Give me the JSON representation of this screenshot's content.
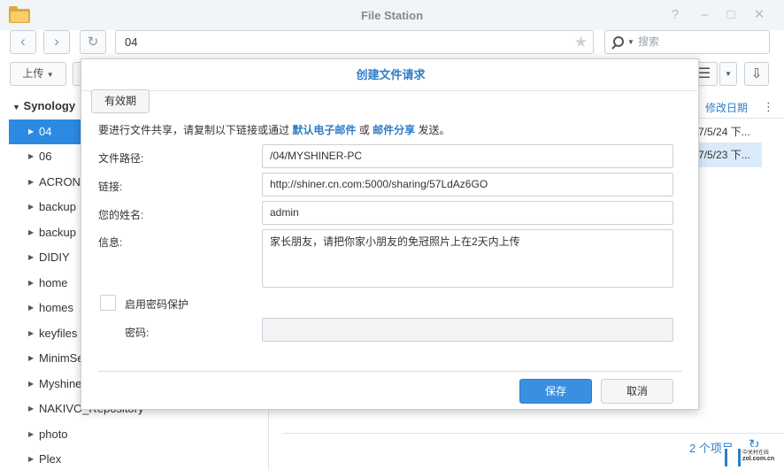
{
  "window": {
    "title": "File Station",
    "controls": [
      "?",
      "–",
      "□",
      "✕"
    ]
  },
  "toolbar": {
    "path": "04",
    "search_placeholder": "搜索",
    "upload_label": "上传"
  },
  "tree": {
    "root": "Synology",
    "items": [
      {
        "label": "04",
        "selected": true
      },
      {
        "label": "06"
      },
      {
        "label": "ACRONI"
      },
      {
        "label": "backup"
      },
      {
        "label": "backup"
      },
      {
        "label": "DIDIY"
      },
      {
        "label": "home"
      },
      {
        "label": "homes"
      },
      {
        "label": "keyfiles"
      },
      {
        "label": "MinimSe"
      },
      {
        "label": "Myshine"
      },
      {
        "label": "NAKIVO_Repository"
      },
      {
        "label": "photo"
      },
      {
        "label": "Plex"
      }
    ]
  },
  "list": {
    "column_modified": "修改日期",
    "rows": [
      {
        "modified": "7/5/24 下..."
      },
      {
        "modified": "7/5/23 下...",
        "selected": true
      }
    ],
    "item_count": "2 个项目"
  },
  "watermark": {
    "line1": "中关村在线",
    "line2": "zol.com.cn"
  },
  "dialog": {
    "title": "创建文件请求",
    "tab_label": "有效期",
    "intro_prefix": "要进行文件共享，请复制以下链接或通过",
    "intro_link1": "默认电子邮件",
    "intro_mid": "或",
    "intro_link2": "邮件分享",
    "intro_suffix": "发送。",
    "path_label": "文件路径:",
    "path_value": "/04/MYSHINER-PC",
    "link_label": "链接:",
    "link_value": "http://shiner.cn.com:5000/sharing/57LdAz6GO",
    "name_label": "您的姓名:",
    "name_value": "admin",
    "message_label": "信息:",
    "message_value": "家长朋友，请把你家小朋友的免冠照片上在2天内上传",
    "password_protect_label": "启用密码保护",
    "password_label": "密码:",
    "password_value": "",
    "save_label": "保存",
    "cancel_label": "取消"
  }
}
